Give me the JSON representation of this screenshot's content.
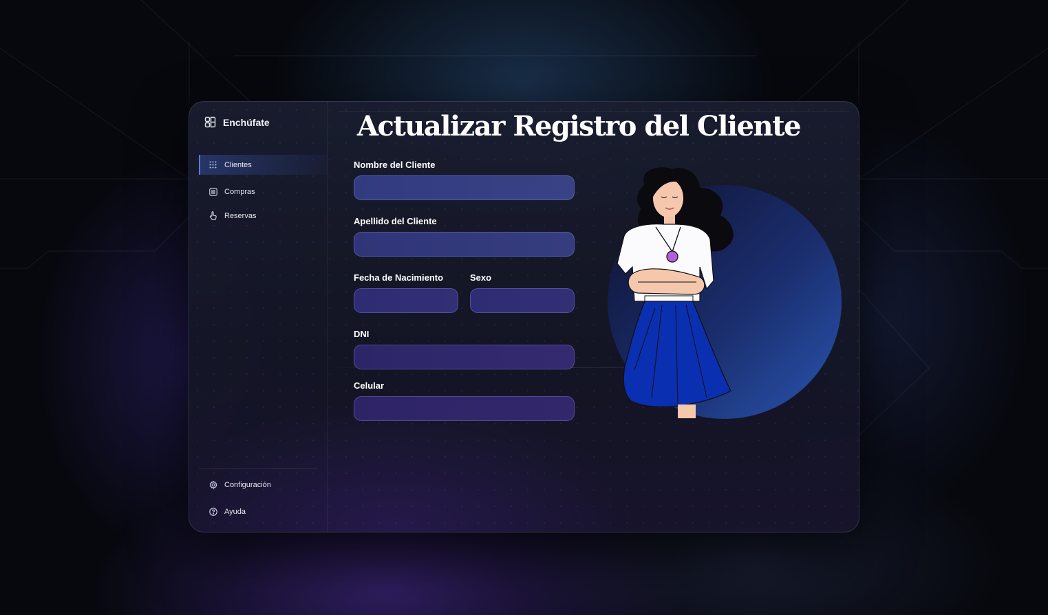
{
  "app": {
    "brand": "Enchúfate"
  },
  "sidebar": {
    "items": [
      {
        "label": "Clientes",
        "icon": "grid-dots-icon",
        "active": true
      },
      {
        "label": "Compras",
        "icon": "list-icon",
        "active": false
      },
      {
        "label": "Reservas",
        "icon": "pointer-hand-icon",
        "active": false
      }
    ],
    "footer_items": [
      {
        "label": "Configuración",
        "icon": "gear-icon"
      },
      {
        "label": "Ayuda",
        "icon": "help-circle-icon"
      }
    ]
  },
  "main": {
    "title": "Actualizar Registro del Cliente",
    "form": {
      "nombre_label": "Nombre del Cliente",
      "nombre_value": "",
      "apellido_label": "Apellido del Cliente",
      "apellido_value": "",
      "fecha_label": "Fecha de Nacimiento",
      "fecha_value": "",
      "sexo_label": "Sexo",
      "sexo_value": "",
      "dni_label": "DNI",
      "dni_value": "",
      "celular_label": "Celular",
      "celular_value": ""
    }
  },
  "colors": {
    "accent": "#5b7bd6",
    "skirt": "#0a2fb0",
    "circle": "#1f3f8f"
  }
}
